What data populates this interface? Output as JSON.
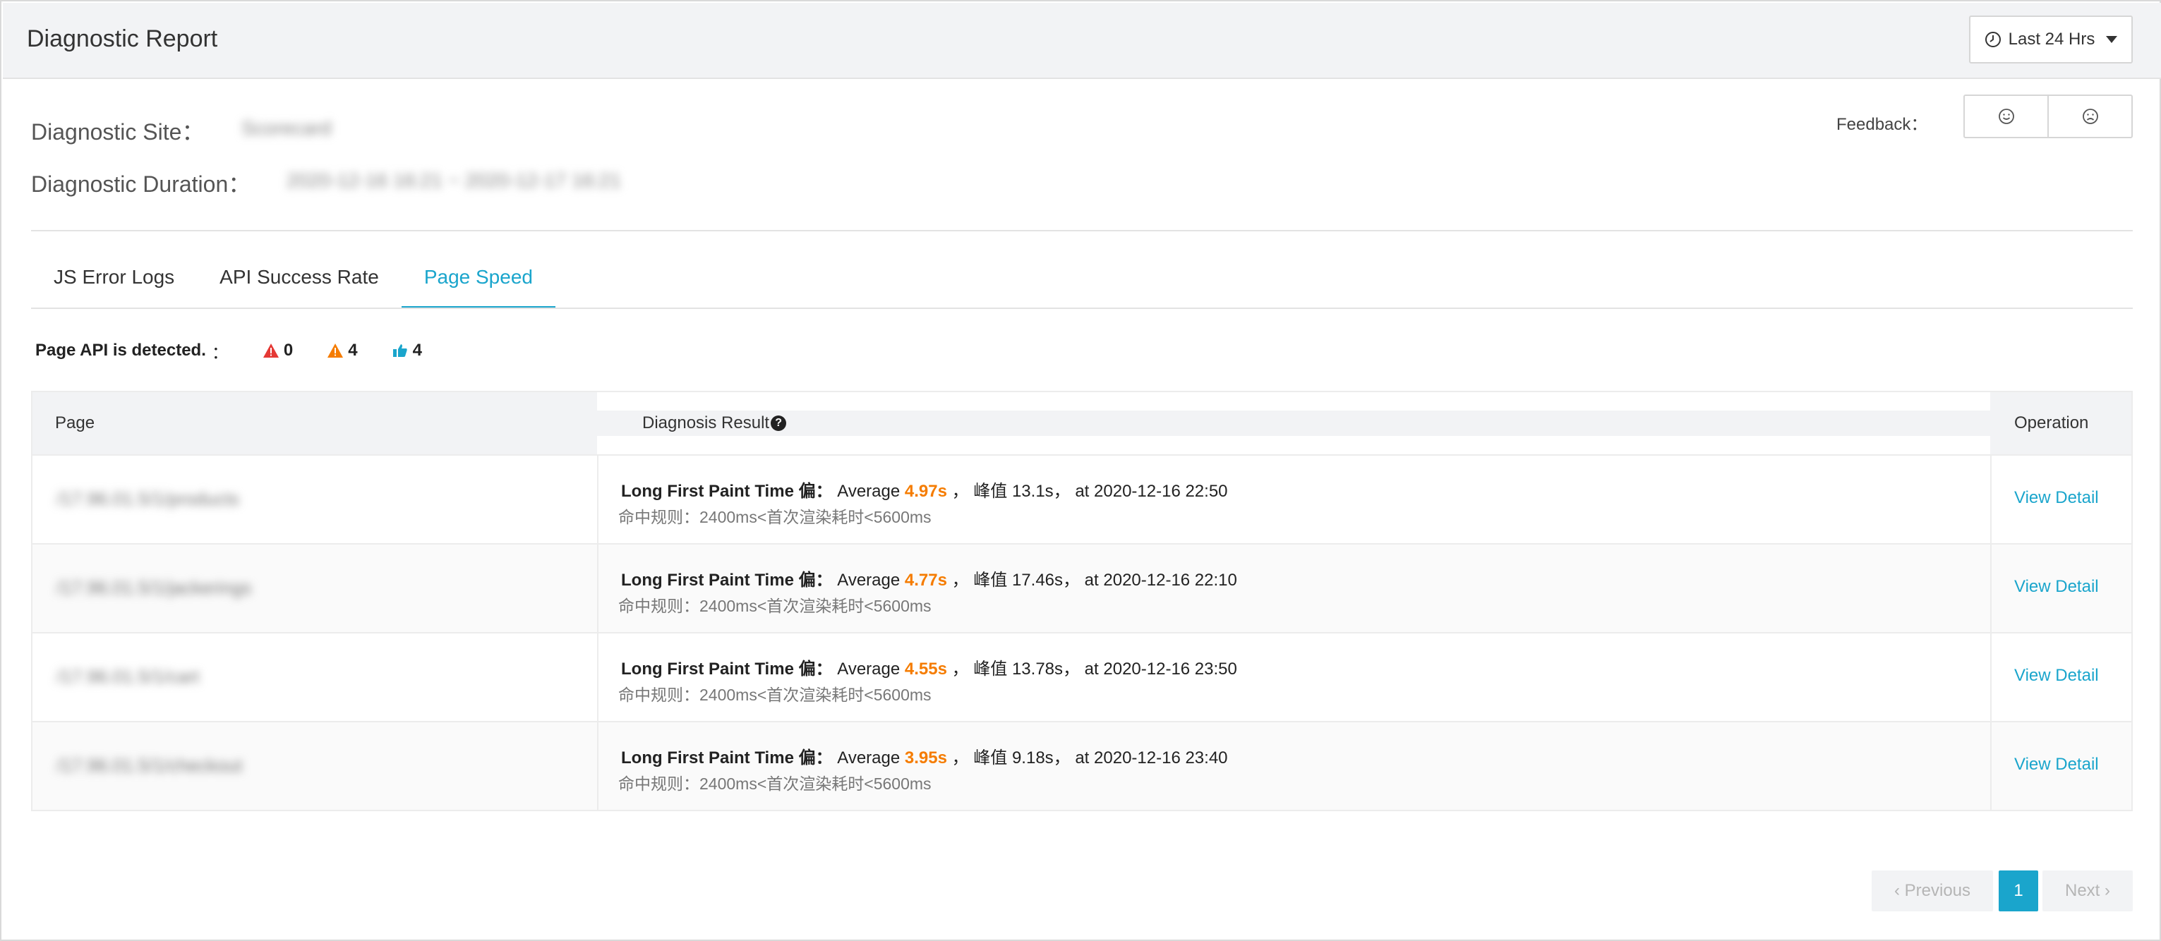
{
  "header": {
    "title": "Diagnostic Report",
    "time_range": "Last 24 Hrs",
    "time_icon": "clock-icon"
  },
  "info": {
    "site_label": "Diagnostic Site：",
    "site_value": "Scorecard",
    "duration_label": "Diagnostic Duration：",
    "duration_value": "2020-12-16 16:21 ~ 2020-12-17 16:21"
  },
  "feedback": {
    "label": "Feedback：",
    "icons": [
      "smile-icon",
      "frown-icon"
    ]
  },
  "tabs": [
    {
      "label": "JS Error Logs"
    },
    {
      "label": "API Success Rate"
    },
    {
      "label": "Page Speed",
      "active": true
    }
  ],
  "summary": {
    "label": "Page API is detected.",
    "colon": "：",
    "error_count": "0",
    "warning_count": "4",
    "good_count": "4",
    "colors": {
      "error": "#e53935",
      "warning": "#f57c00",
      "good": "#1aa5cc"
    }
  },
  "table": {
    "headers": {
      "page": "Page",
      "diagnosis": "Diagnosis Result",
      "help": "?",
      "operation": "Operation"
    },
    "rows": [
      {
        "page": "/17.96.01.5/1/products",
        "title": "Long First Paint Time 偏：",
        "avg_label": "Average",
        "avg_value": "4.97s",
        "peak": "，  峰值 13.1s，  at  2020-12-16 22:50",
        "rule": "命中规则：2400ms<首次渲染耗时<5600ms",
        "action": "View Detail"
      },
      {
        "page": "/17.96.01.5/1/jackerings",
        "title": "Long First Paint Time 偏：",
        "avg_label": "Average",
        "avg_value": "4.77s",
        "peak": "，  峰值 17.46s，  at  2020-12-16 22:10",
        "rule": "命中规则：2400ms<首次渲染耗时<5600ms",
        "action": "View Detail"
      },
      {
        "page": "/17.96.01.5/1/cart",
        "title": "Long First Paint Time 偏：",
        "avg_label": "Average",
        "avg_value": "4.55s",
        "peak": "，  峰值 13.78s，  at  2020-12-16 23:50",
        "rule": "命中规则：2400ms<首次渲染耗时<5600ms",
        "action": "View Detail"
      },
      {
        "page": "/17.96.01.5/1/checkout",
        "title": "Long First Paint Time 偏：",
        "avg_label": "Average",
        "avg_value": "3.95s",
        "peak": "，  峰值 9.18s，  at  2020-12-16 23:40",
        "rule": "命中规则：2400ms<首次渲染耗时<5600ms",
        "action": "View Detail"
      }
    ]
  },
  "pagination": {
    "previous": "Previous",
    "current": "1",
    "next": "Next",
    "accent": "#1aa5cc"
  }
}
